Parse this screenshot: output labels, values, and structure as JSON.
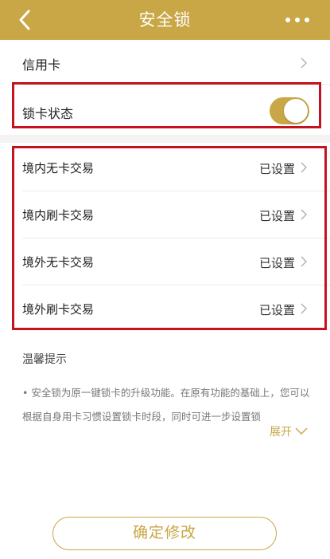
{
  "header": {
    "title": "安全锁",
    "accent_color": "#c9a646",
    "back_icon": "chevron-left-icon",
    "more_icon": "more-dots-icon"
  },
  "card_row": {
    "label": "信用卡"
  },
  "lock_status": {
    "label": "锁卡状态",
    "enabled": true
  },
  "transactions": [
    {
      "label": "境内无卡交易",
      "value": "已设置"
    },
    {
      "label": "境内刷卡交易",
      "value": "已设置"
    },
    {
      "label": "境外无卡交易",
      "value": "已设置"
    },
    {
      "label": "境外刷卡交易",
      "value": "已设置"
    }
  ],
  "tips": {
    "title": "温馨提示",
    "text": "• 安全锁为原一键锁卡的升级功能。在原有功能的基础上，您可以根据自身用卡习惯设置锁卡时段，同时可进一步设置锁",
    "expand_label": "展开"
  },
  "confirm_button": {
    "label": "确定修改"
  },
  "highlight_color": "#c4121f"
}
